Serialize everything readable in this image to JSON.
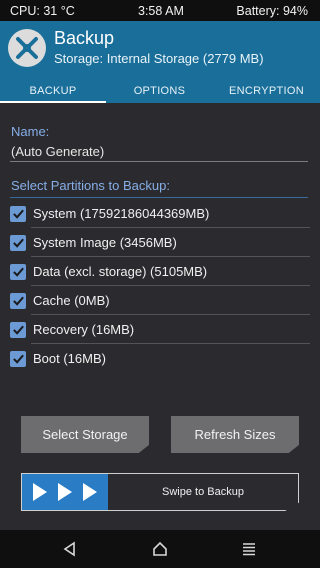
{
  "status_bar": {
    "cpu": "CPU: 31 °C",
    "time": "3:58 AM",
    "battery": "Battery: 94%"
  },
  "header": {
    "title": "Backup",
    "storage": "Storage: Internal Storage (2779 MB)",
    "logo_icon": "twrp-logo-icon"
  },
  "tabs": [
    {
      "label": "BACKUP",
      "active": true
    },
    {
      "label": "OPTIONS",
      "active": false
    },
    {
      "label": "ENCRYPTION",
      "active": false
    }
  ],
  "name": {
    "label": "Name:",
    "value": "(Auto Generate)"
  },
  "partitions": {
    "label": "Select Partitions to Backup:",
    "items": [
      {
        "label": "System (17592186044369MB)",
        "checked": true
      },
      {
        "label": "System Image (3456MB)",
        "checked": true
      },
      {
        "label": "Data (excl. storage) (5105MB)",
        "checked": true
      },
      {
        "label": "Cache (0MB)",
        "checked": true
      },
      {
        "label": "Recovery (16MB)",
        "checked": true
      },
      {
        "label": "Boot (16MB)",
        "checked": true
      }
    ]
  },
  "buttons": {
    "select_storage": "Select Storage",
    "refresh_sizes": "Refresh Sizes"
  },
  "swipe": {
    "label": "Swipe to Backup"
  },
  "colors": {
    "header": "#1a6f9a",
    "panel": "#2b2b2f",
    "accent_label": "#86aee7",
    "checkbox": "#6c9ad4",
    "swipe_handle": "#2a7dc4",
    "button": "#6d6d70"
  },
  "navbar": {
    "back_icon": "back-triangle-icon",
    "home_icon": "home-icon",
    "menu_icon": "menu-icon"
  }
}
